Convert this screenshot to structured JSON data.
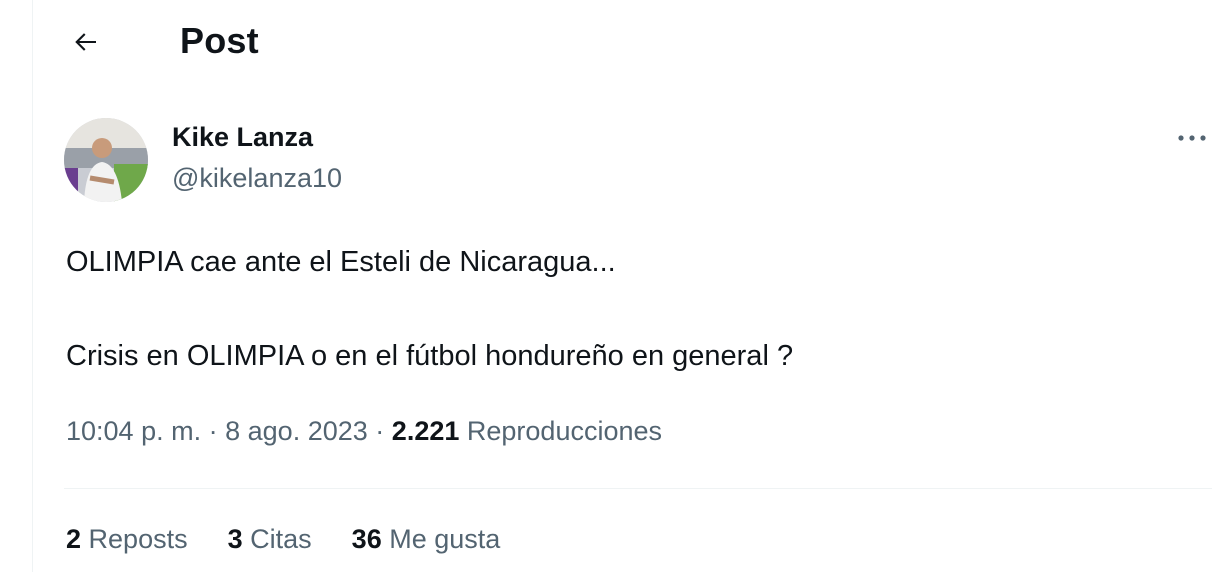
{
  "header": {
    "title": "Post"
  },
  "author": {
    "name": "Kike Lanza",
    "handle": "@kikelanza10"
  },
  "post": {
    "line1": "OLIMPIA cae ante el Esteli de Nicaragua...",
    "line2": "Crisis en OLIMPIA o en el fútbol hondureño en general ?"
  },
  "meta": {
    "time": "10:04 p. m.",
    "separator": "·",
    "date": "8 ago. 2023",
    "views_count": "2.221",
    "views_label": "Reproducciones"
  },
  "stats": [
    {
      "count": "2",
      "label": "Reposts"
    },
    {
      "count": "3",
      "label": "Citas"
    },
    {
      "count": "36",
      "label": "Me gusta"
    }
  ],
  "icons": {
    "back": "arrow-left-icon",
    "more": "more-horizontal-icon"
  }
}
